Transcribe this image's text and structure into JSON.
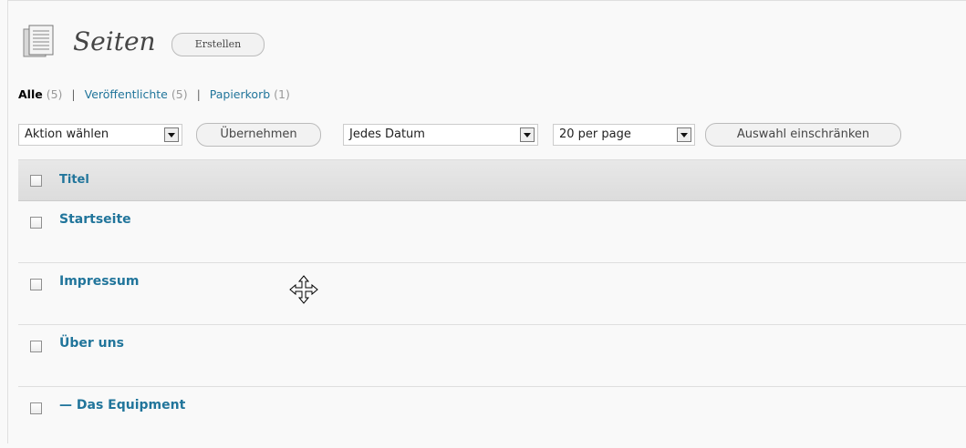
{
  "header": {
    "title": "Seiten",
    "create_label": "Erstellen"
  },
  "filters": [
    {
      "label": "Alle",
      "count": "(5)"
    },
    {
      "label": "Veröffentlichte",
      "count": "(5)"
    },
    {
      "label": "Papierkorb",
      "count": "(1)"
    }
  ],
  "bulk": {
    "action_value": "Aktion wählen",
    "apply_label": "Übernehmen"
  },
  "date_filter": {
    "value": "Jedes Datum"
  },
  "per_page": {
    "value": "20 per page"
  },
  "filter_button_label": "Auswahl einschränken",
  "table": {
    "header_title": "Titel",
    "rows": [
      {
        "title": "Startseite"
      },
      {
        "title": "Impressum"
      },
      {
        "title": "Über uns"
      },
      {
        "title": "— Das Equipment"
      }
    ]
  },
  "colors": {
    "link": "#21759b",
    "background": "#f9f9f9"
  },
  "icons": [
    "pages-icon",
    "move-cursor-icon"
  ]
}
